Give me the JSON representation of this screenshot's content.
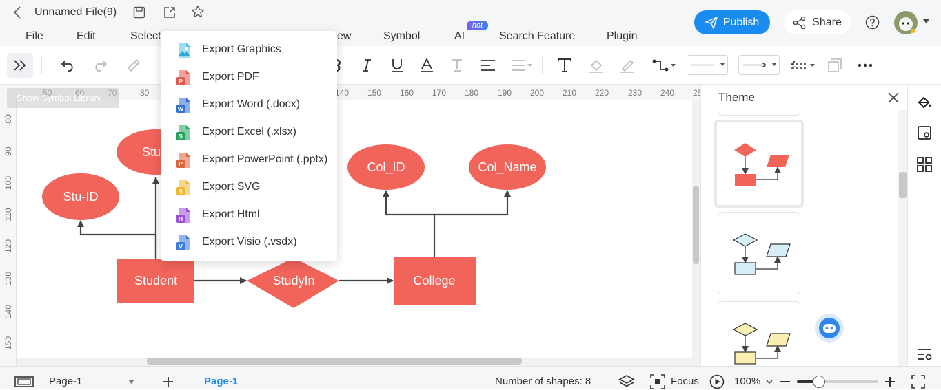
{
  "header": {
    "file_title": "Unnamed File(9)",
    "menu": [
      "File",
      "Edit",
      "Select",
      "ew",
      "Symbol",
      "AI",
      "Search Feature",
      "Plugin"
    ],
    "ai_badge": "hot",
    "publish_label": "Publish",
    "share_label": "Share"
  },
  "ruler": {
    "h_ticks": [
      "50",
      "60",
      "70",
      "80",
      "140",
      "150",
      "160",
      "170",
      "180",
      "190",
      "200",
      "210",
      "220",
      "230",
      "240",
      "25"
    ],
    "v_ticks": [
      "80",
      "90",
      "100",
      "110",
      "120",
      "130",
      "140",
      "150"
    ]
  },
  "symbol_library_hint": "Show Symbol Library",
  "export_menu": [
    {
      "label": "Export Graphics",
      "icon": "image-file-icon",
      "color": "#4ec3e6",
      "letter": ""
    },
    {
      "label": "Export PDF",
      "icon": "pdf-file-icon",
      "color": "#e4574a",
      "letter": "P"
    },
    {
      "label": "Export Word (.docx)",
      "icon": "word-file-icon",
      "color": "#2f6fd6",
      "letter": "W"
    },
    {
      "label": "Export Excel (.xlsx)",
      "icon": "excel-file-icon",
      "color": "#21a05a",
      "letter": "S"
    },
    {
      "label": "Export PowerPoint (.pptx)",
      "icon": "powerpoint-file-icon",
      "color": "#e0623a",
      "letter": "P"
    },
    {
      "label": "Export SVG",
      "icon": "svg-file-icon",
      "color": "#f2b530",
      "letter": "S"
    },
    {
      "label": "Export Html",
      "icon": "html-file-icon",
      "color": "#9b4ddb",
      "letter": "H"
    },
    {
      "label": "Export Visio (.vsdx)",
      "icon": "visio-file-icon",
      "color": "#3a78e0",
      "letter": "V"
    }
  ],
  "diagram": {
    "colors": {
      "shape": "#f0645a",
      "text": "#ffffff",
      "connector": "#444444"
    },
    "entities": {
      "student": "Student",
      "college": "College"
    },
    "relationship": "StudyIn",
    "attributes": {
      "stu_id": "Stu-ID",
      "stu_name": "Stu-N",
      "col_id": "Col_ID",
      "col_name": "Col_Name"
    }
  },
  "theme_panel": {
    "title": "Theme",
    "themes": [
      {
        "name": "red-theme",
        "fill": "#f0645a",
        "stroke": "#f0645a"
      },
      {
        "name": "blue-theme",
        "fill": "#d6eef7",
        "stroke": "#333333"
      },
      {
        "name": "yellow-theme",
        "fill": "#faeeb0",
        "stroke": "#333333"
      }
    ]
  },
  "status": {
    "page_selector": "Page-1",
    "active_page_tab": "Page-1",
    "shapes_count": "Number of shapes: 8",
    "focus_label": "Focus",
    "zoom": "100%"
  },
  "accent_color": "#1a8cf0"
}
